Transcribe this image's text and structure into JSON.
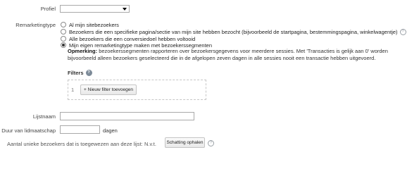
{
  "profile": {
    "label": "Profiel",
    "value": ""
  },
  "remarketing": {
    "label": "Remarketingtype",
    "options": [
      {
        "label": "Al mijn sitebezoekers",
        "checked": false
      },
      {
        "label": "Bezoekers die een specifieke pagina/sectie van mijn site hebben bezocht (bijvoorbeeld de startpagina, bestemmingspagina, winkelwagentje)",
        "checked": false
      },
      {
        "label": "Alle bezoekers die een conversiedoel hebben voltooid",
        "checked": false
      },
      {
        "label": "Mijn eigen remarketingtype maken met bezoekerssegmenten",
        "checked": true
      }
    ],
    "note_bold": "Opmerking:",
    "note_text": "bezoekerssegmenten rapporteren over bezoekersgegevens voor meerdere sessies. Met 'Transacties is gelijk aan 0' worden bijvoorbeeld alleen bezoekers geselecteerd die in de afgelopen zeven dagen in alle sessies nooit een transactie hebben uitgevoerd."
  },
  "filters": {
    "title": "Filters",
    "row_number": "1",
    "add_button": "+ Nieuw filter toevoegen"
  },
  "list_name": {
    "label": "Lijstnaam",
    "value": ""
  },
  "duration": {
    "label": "Duur van lidmaatschap",
    "value": "",
    "unit": "dagen"
  },
  "audience": {
    "label": "Aantal unieke bezoekers dat is toegewezen aan deze lijst:",
    "value": "N.v.t.",
    "button": "Schatting ophalen"
  },
  "help_glyph": "?"
}
